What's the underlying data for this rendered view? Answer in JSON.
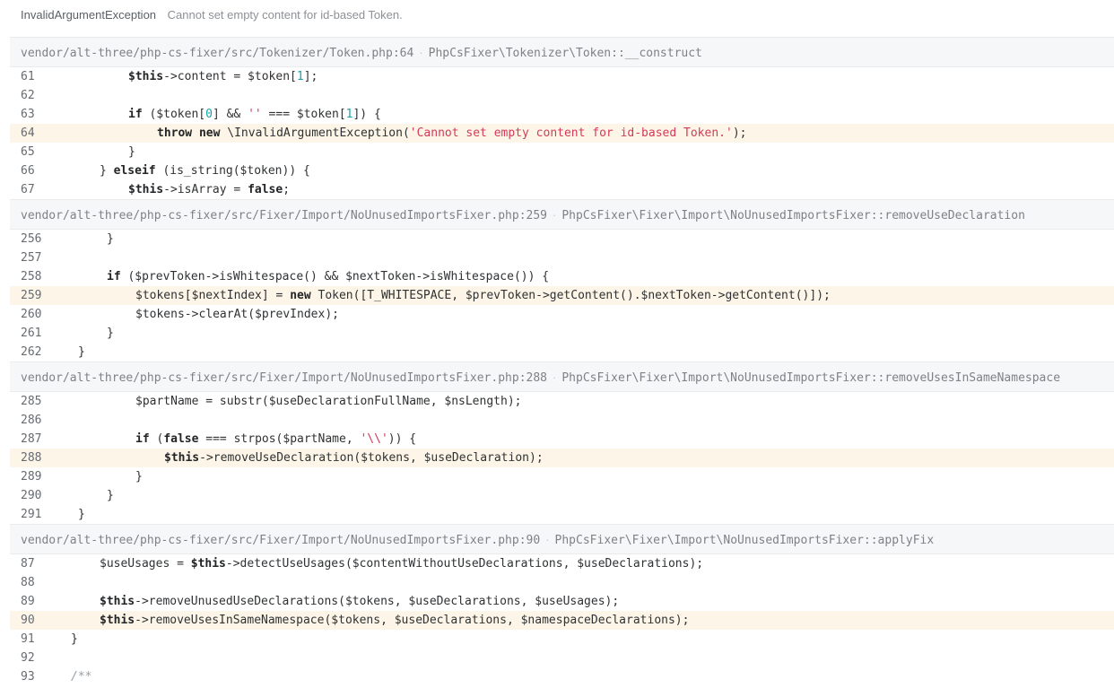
{
  "exception": {
    "class_name": "InvalidArgumentException",
    "message": "Cannot set empty content for id-based Token."
  },
  "frames": [
    {
      "file": "vendor/alt-three/php-cs-fixer/src/Tokenizer/Token.php:64",
      "method": "PhpCsFixer\\Tokenizer\\Token::__construct",
      "lines": [
        {
          "no": "61",
          "highlight": false,
          "indent": 120,
          "tokens": [
            {
              "t": "kw",
              "v": "$this"
            },
            {
              "t": "plain",
              "v": "->content = $token["
            },
            {
              "t": "num",
              "v": "1"
            },
            {
              "t": "plain",
              "v": "];"
            }
          ]
        },
        {
          "no": "62",
          "highlight": false,
          "indent": 0,
          "tokens": []
        },
        {
          "no": "63",
          "highlight": false,
          "indent": 120,
          "tokens": [
            {
              "t": "kw",
              "v": "if"
            },
            {
              "t": "plain",
              "v": " ($token["
            },
            {
              "t": "num",
              "v": "0"
            },
            {
              "t": "plain",
              "v": "] && "
            },
            {
              "t": "str",
              "v": "''"
            },
            {
              "t": "plain",
              "v": " === $token["
            },
            {
              "t": "num",
              "v": "1"
            },
            {
              "t": "plain",
              "v": "]) {"
            }
          ]
        },
        {
          "no": "64",
          "highlight": true,
          "indent": 152,
          "tokens": [
            {
              "t": "kw",
              "v": "throw"
            },
            {
              "t": "plain",
              "v": " "
            },
            {
              "t": "kw",
              "v": "new"
            },
            {
              "t": "plain",
              "v": " \\InvalidArgumentException("
            },
            {
              "t": "str",
              "v": "'Cannot set empty content for id-based Token.'"
            },
            {
              "t": "plain",
              "v": ");"
            }
          ]
        },
        {
          "no": "65",
          "highlight": false,
          "indent": 120,
          "tokens": [
            {
              "t": "plain",
              "v": "}"
            }
          ]
        },
        {
          "no": "66",
          "highlight": false,
          "indent": 88,
          "tokens": [
            {
              "t": "plain",
              "v": "} "
            },
            {
              "t": "kw",
              "v": "elseif"
            },
            {
              "t": "plain",
              "v": " (is_string($token)) {"
            }
          ]
        },
        {
          "no": "67",
          "highlight": false,
          "indent": 120,
          "tokens": [
            {
              "t": "kw",
              "v": "$this"
            },
            {
              "t": "plain",
              "v": "->isArray = "
            },
            {
              "t": "kw",
              "v": "false"
            },
            {
              "t": "plain",
              "v": ";"
            }
          ]
        }
      ]
    },
    {
      "file": "vendor/alt-three/php-cs-fixer/src/Fixer/Import/NoUnusedImportsFixer.php:259",
      "method": "PhpCsFixer\\Fixer\\Import\\NoUnusedImportsFixer::removeUseDeclaration",
      "lines": [
        {
          "no": "256",
          "highlight": false,
          "indent": 96,
          "tokens": [
            {
              "t": "plain",
              "v": "}"
            }
          ]
        },
        {
          "no": "257",
          "highlight": false,
          "indent": 0,
          "tokens": []
        },
        {
          "no": "258",
          "highlight": false,
          "indent": 96,
          "tokens": [
            {
              "t": "kw",
              "v": "if"
            },
            {
              "t": "plain",
              "v": " ($prevToken->isWhitespace() && $nextToken->isWhitespace()) {"
            }
          ]
        },
        {
          "no": "259",
          "highlight": true,
          "indent": 128,
          "tokens": [
            {
              "t": "plain",
              "v": "$tokens[$nextIndex] = "
            },
            {
              "t": "kw",
              "v": "new"
            },
            {
              "t": "plain",
              "v": " Token([T_WHITESPACE, $prevToken->getContent().$nextToken->getContent()]);"
            }
          ]
        },
        {
          "no": "260",
          "highlight": false,
          "indent": 128,
          "tokens": [
            {
              "t": "plain",
              "v": "$tokens->clearAt($prevIndex);"
            }
          ]
        },
        {
          "no": "261",
          "highlight": false,
          "indent": 96,
          "tokens": [
            {
              "t": "plain",
              "v": "}"
            }
          ]
        },
        {
          "no": "262",
          "highlight": false,
          "indent": 64,
          "tokens": [
            {
              "t": "plain",
              "v": "}"
            }
          ]
        }
      ]
    },
    {
      "file": "vendor/alt-three/php-cs-fixer/src/Fixer/Import/NoUnusedImportsFixer.php:288",
      "method": "PhpCsFixer\\Fixer\\Import\\NoUnusedImportsFixer::removeUsesInSameNamespace",
      "lines": [
        {
          "no": "285",
          "highlight": false,
          "indent": 128,
          "tokens": [
            {
              "t": "plain",
              "v": "$partName = substr($useDeclarationFullName, $nsLength);"
            }
          ]
        },
        {
          "no": "286",
          "highlight": false,
          "indent": 0,
          "tokens": []
        },
        {
          "no": "287",
          "highlight": false,
          "indent": 128,
          "tokens": [
            {
              "t": "kw",
              "v": "if"
            },
            {
              "t": "plain",
              "v": " ("
            },
            {
              "t": "kw",
              "v": "false"
            },
            {
              "t": "plain",
              "v": " === strpos($partName, "
            },
            {
              "t": "str",
              "v": "'\\\\'"
            },
            {
              "t": "plain",
              "v": ")) {"
            }
          ]
        },
        {
          "no": "288",
          "highlight": true,
          "indent": 160,
          "tokens": [
            {
              "t": "kw",
              "v": "$this"
            },
            {
              "t": "plain",
              "v": "->removeUseDeclaration($tokens, $useDeclaration);"
            }
          ]
        },
        {
          "no": "289",
          "highlight": false,
          "indent": 128,
          "tokens": [
            {
              "t": "plain",
              "v": "}"
            }
          ]
        },
        {
          "no": "290",
          "highlight": false,
          "indent": 96,
          "tokens": [
            {
              "t": "plain",
              "v": "}"
            }
          ]
        },
        {
          "no": "291",
          "highlight": false,
          "indent": 64,
          "tokens": [
            {
              "t": "plain",
              "v": "}"
            }
          ]
        }
      ]
    },
    {
      "file": "vendor/alt-three/php-cs-fixer/src/Fixer/Import/NoUnusedImportsFixer.php:90",
      "method": "PhpCsFixer\\Fixer\\Import\\NoUnusedImportsFixer::applyFix",
      "lines": [
        {
          "no": "87",
          "highlight": false,
          "indent": 88,
          "tokens": [
            {
              "t": "plain",
              "v": "$useUsages = "
            },
            {
              "t": "kw",
              "v": "$this"
            },
            {
              "t": "plain",
              "v": "->detectUseUsages($contentWithoutUseDeclarations, $useDeclarations);"
            }
          ]
        },
        {
          "no": "88",
          "highlight": false,
          "indent": 0,
          "tokens": []
        },
        {
          "no": "89",
          "highlight": false,
          "indent": 88,
          "tokens": [
            {
              "t": "kw",
              "v": "$this"
            },
            {
              "t": "plain",
              "v": "->removeUnusedUseDeclarations($tokens, $useDeclarations, $useUsages);"
            }
          ]
        },
        {
          "no": "90",
          "highlight": true,
          "indent": 88,
          "tokens": [
            {
              "t": "kw",
              "v": "$this"
            },
            {
              "t": "plain",
              "v": "->removeUsesInSameNamespace($tokens, $useDeclarations, $namespaceDeclarations);"
            }
          ]
        },
        {
          "no": "91",
          "highlight": false,
          "indent": 56,
          "tokens": [
            {
              "t": "plain",
              "v": "}"
            }
          ]
        },
        {
          "no": "92",
          "highlight": false,
          "indent": 0,
          "tokens": []
        },
        {
          "no": "93",
          "highlight": false,
          "indent": 56,
          "tokens": [
            {
              "t": "comment",
              "v": "/**"
            }
          ]
        }
      ]
    }
  ]
}
